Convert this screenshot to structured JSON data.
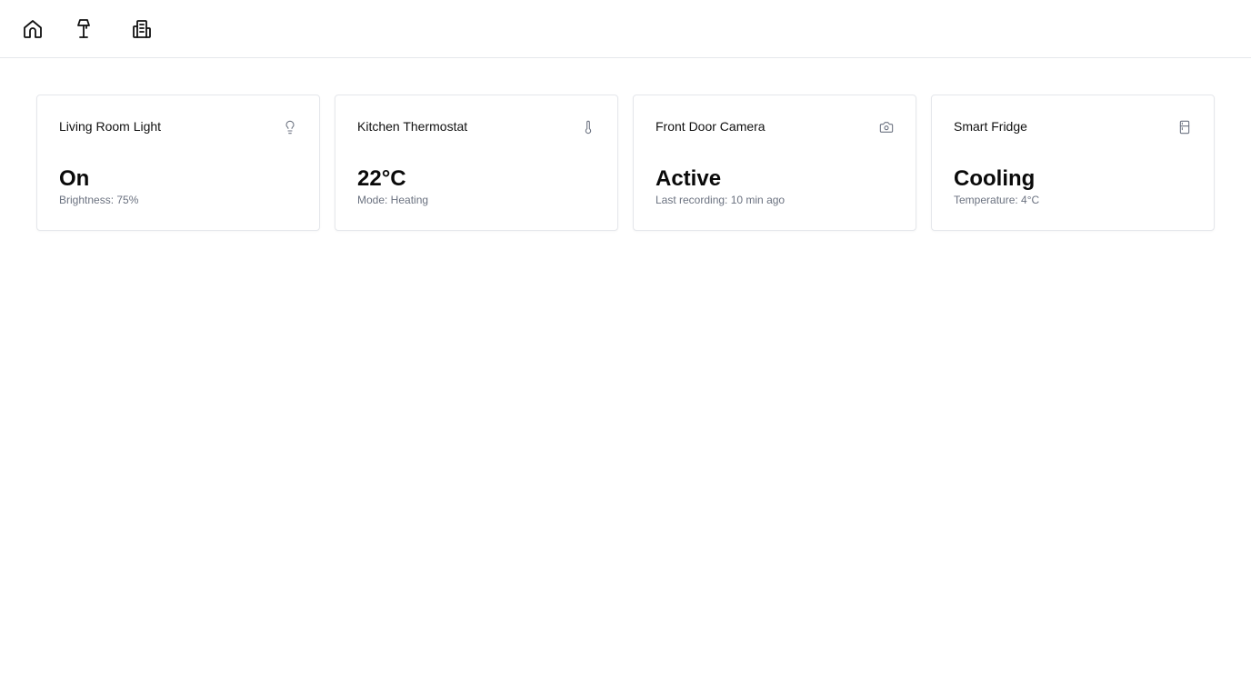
{
  "nav": {
    "items": [
      {
        "icon": "home-icon"
      },
      {
        "icon": "lamp-icon"
      },
      {
        "icon": "building-icon"
      }
    ]
  },
  "devices": [
    {
      "title": "Living Room Light",
      "icon": "lightbulb-icon",
      "value": "On",
      "detail": "Brightness: 75%"
    },
    {
      "title": "Kitchen Thermostat",
      "icon": "thermometer-icon",
      "value": "22°C",
      "detail": "Mode: Heating"
    },
    {
      "title": "Front Door Camera",
      "icon": "camera-icon",
      "value": "Active",
      "detail": "Last recording: 10 min ago"
    },
    {
      "title": "Smart Fridge",
      "icon": "fridge-icon",
      "value": "Cooling",
      "detail": "Temperature: 4°C"
    }
  ],
  "colors": {
    "text": "#111111",
    "muted": "#6b7280",
    "border": "#e5e7eb",
    "icon": "#6b7280"
  }
}
